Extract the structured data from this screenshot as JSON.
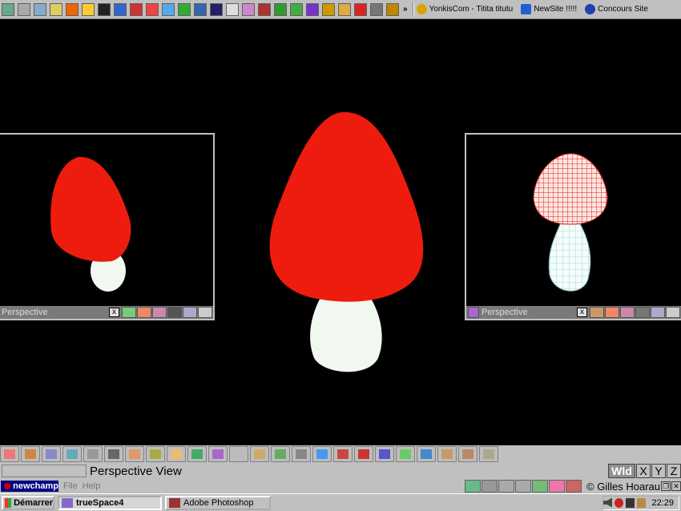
{
  "top_bar": {
    "quicklaunch_icons": [
      "desktop-icon",
      "card-icon",
      "find-icon",
      "photo-icon",
      "runner-icon",
      "warning-icon",
      "figure-icon",
      "ie-icon",
      "aim-icon",
      "bullseye-icon",
      "mail-icon",
      "xmark-icon",
      "mailbox-icon",
      "user-icon",
      "face-icon",
      "star-icon",
      "film-icon",
      "grid-icon",
      "globe-icon",
      "book-icon",
      "pencil-icon",
      "folder-icon",
      "red-icon",
      "calc-icon",
      "gear-icon"
    ],
    "overflow_label": "»",
    "links": [
      {
        "label": "YonkisCom - Titita titutu",
        "icon": "yonkis-icon",
        "color": "#d9a400"
      },
      {
        "label": "NewSite !!!!!",
        "icon": "ie-page-icon",
        "color": "#2060d0"
      },
      {
        "label": "Concours Site",
        "icon": "w-icon",
        "color": "#2040b0"
      }
    ]
  },
  "viewports": {
    "left": {
      "title": "Perspective",
      "close_label": "x"
    },
    "right": {
      "title": "Perspective",
      "close_label": "x"
    }
  },
  "status": {
    "view_label": "Perspective View",
    "axis_buttons": [
      "Wld",
      "X",
      "Y",
      "Z"
    ]
  },
  "menubar": {
    "app_name": "newchamp",
    "menus": [
      "File",
      "Help"
    ],
    "copyright": "© Gilles Hoarau"
  },
  "taskbar": {
    "start_label": "Démarrer",
    "tasks": [
      {
        "label": "trueSpace4",
        "active": true
      },
      {
        "label": "Adobe Photoshop",
        "active": false
      }
    ],
    "clock": "22:29"
  },
  "colors": {
    "cap_red": "#ee1c0e",
    "stem_white": "#f0f8f0",
    "wireframe_red": "#e02020",
    "wireframe_stem": "#d8f4f4",
    "chrome_gray": "#c0c0c0"
  }
}
